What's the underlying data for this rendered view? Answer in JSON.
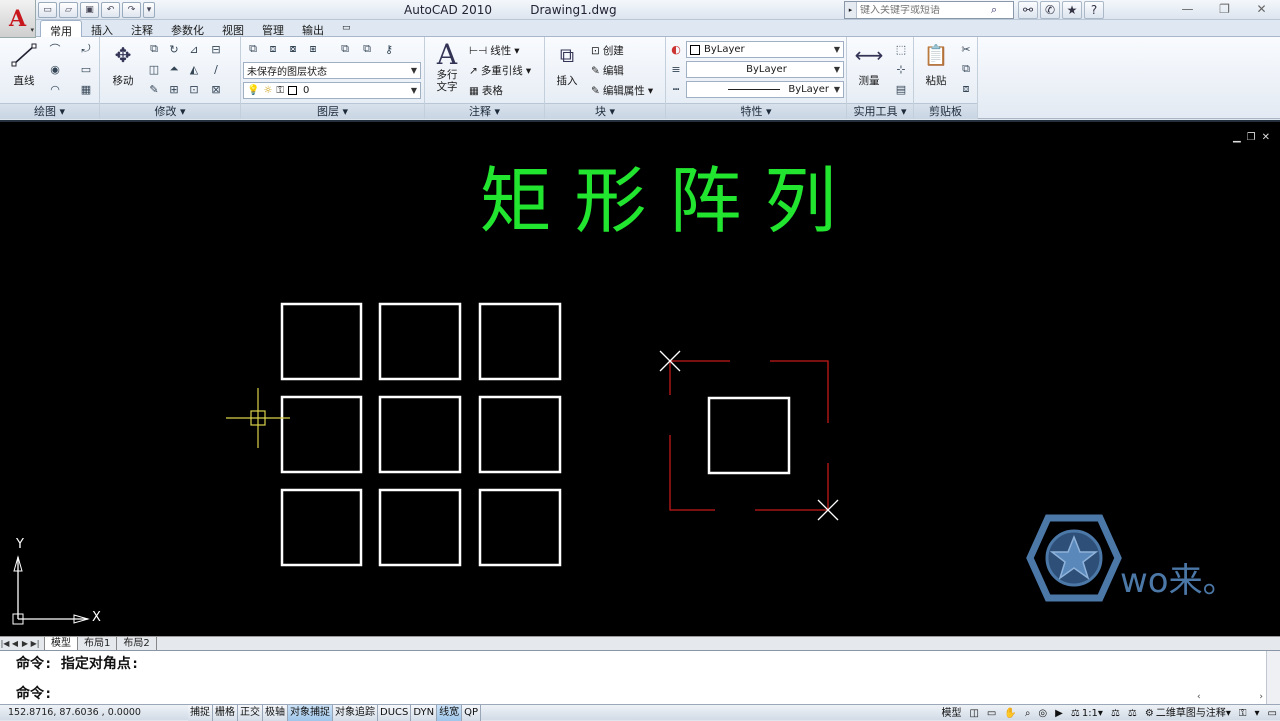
{
  "app": {
    "title": "AutoCAD 2010",
    "document": "Drawing1.dwg"
  },
  "search": {
    "placeholder": "键入关键字或短语"
  },
  "tabs": [
    {
      "label": "常用"
    },
    {
      "label": "插入"
    },
    {
      "label": "注释"
    },
    {
      "label": "参数化"
    },
    {
      "label": "视图"
    },
    {
      "label": "管理"
    },
    {
      "label": "输出"
    }
  ],
  "ribbon": {
    "draw": {
      "title": "绘图 ▾",
      "line_label": "直线"
    },
    "modify": {
      "title": "修改 ▾",
      "move_label": "移动"
    },
    "layers": {
      "title": "图层 ▾",
      "state": "未保存的图层状态",
      "current_layer": "0"
    },
    "annotation": {
      "title": "注释 ▾",
      "mtext_label_1": "多行",
      "mtext_label_2": "文字",
      "linear": "线性",
      "mleader": "多重引线",
      "table": "表格"
    },
    "block": {
      "title": "块 ▾",
      "insert_label": "插入",
      "create": "创建",
      "edit": "编辑",
      "edit_attr": "编辑属性"
    },
    "properties": {
      "title": "特性 ▾",
      "color": "ByLayer",
      "linetype": "ByLayer",
      "lineweight": "ByLayer"
    },
    "utilities": {
      "title": "实用工具 ▾",
      "measure_label": "测量"
    },
    "clipboard": {
      "title": "剪贴板",
      "paste_label": "粘贴"
    }
  },
  "canvas": {
    "heading": "矩 形 阵 列",
    "ucs_x": "X",
    "ucs_y": "Y",
    "watermark_text": "wo来。"
  },
  "layout_tabs": [
    {
      "label": "模型"
    },
    {
      "label": "布局1"
    },
    {
      "label": "布局2"
    }
  ],
  "command": {
    "history": "命令: 指定对角点:",
    "prompt": "命令:"
  },
  "status": {
    "coords": "152.8716, 87.6036 , 0.0000",
    "toggles": [
      {
        "label": "捕捉",
        "on": false
      },
      {
        "label": "栅格",
        "on": false
      },
      {
        "label": "正交",
        "on": false
      },
      {
        "label": "极轴",
        "on": false
      },
      {
        "label": "对象捕捉",
        "on": true
      },
      {
        "label": "对象追踪",
        "on": false
      },
      {
        "label": "DUCS",
        "on": false
      },
      {
        "label": "DYN",
        "on": false
      },
      {
        "label": "线宽",
        "on": true
      },
      {
        "label": "QP",
        "on": false
      }
    ],
    "model_label": "模型",
    "scale": "1:1",
    "workspace": "二维草图与注释"
  },
  "colors": {
    "canvas_bg": "#000000",
    "heading": "#22e52f",
    "selection_box": "#c21a1a",
    "grip_cross": "#ffffff",
    "crosshair": "#d9d34a",
    "watermark": "#4c78a8"
  }
}
